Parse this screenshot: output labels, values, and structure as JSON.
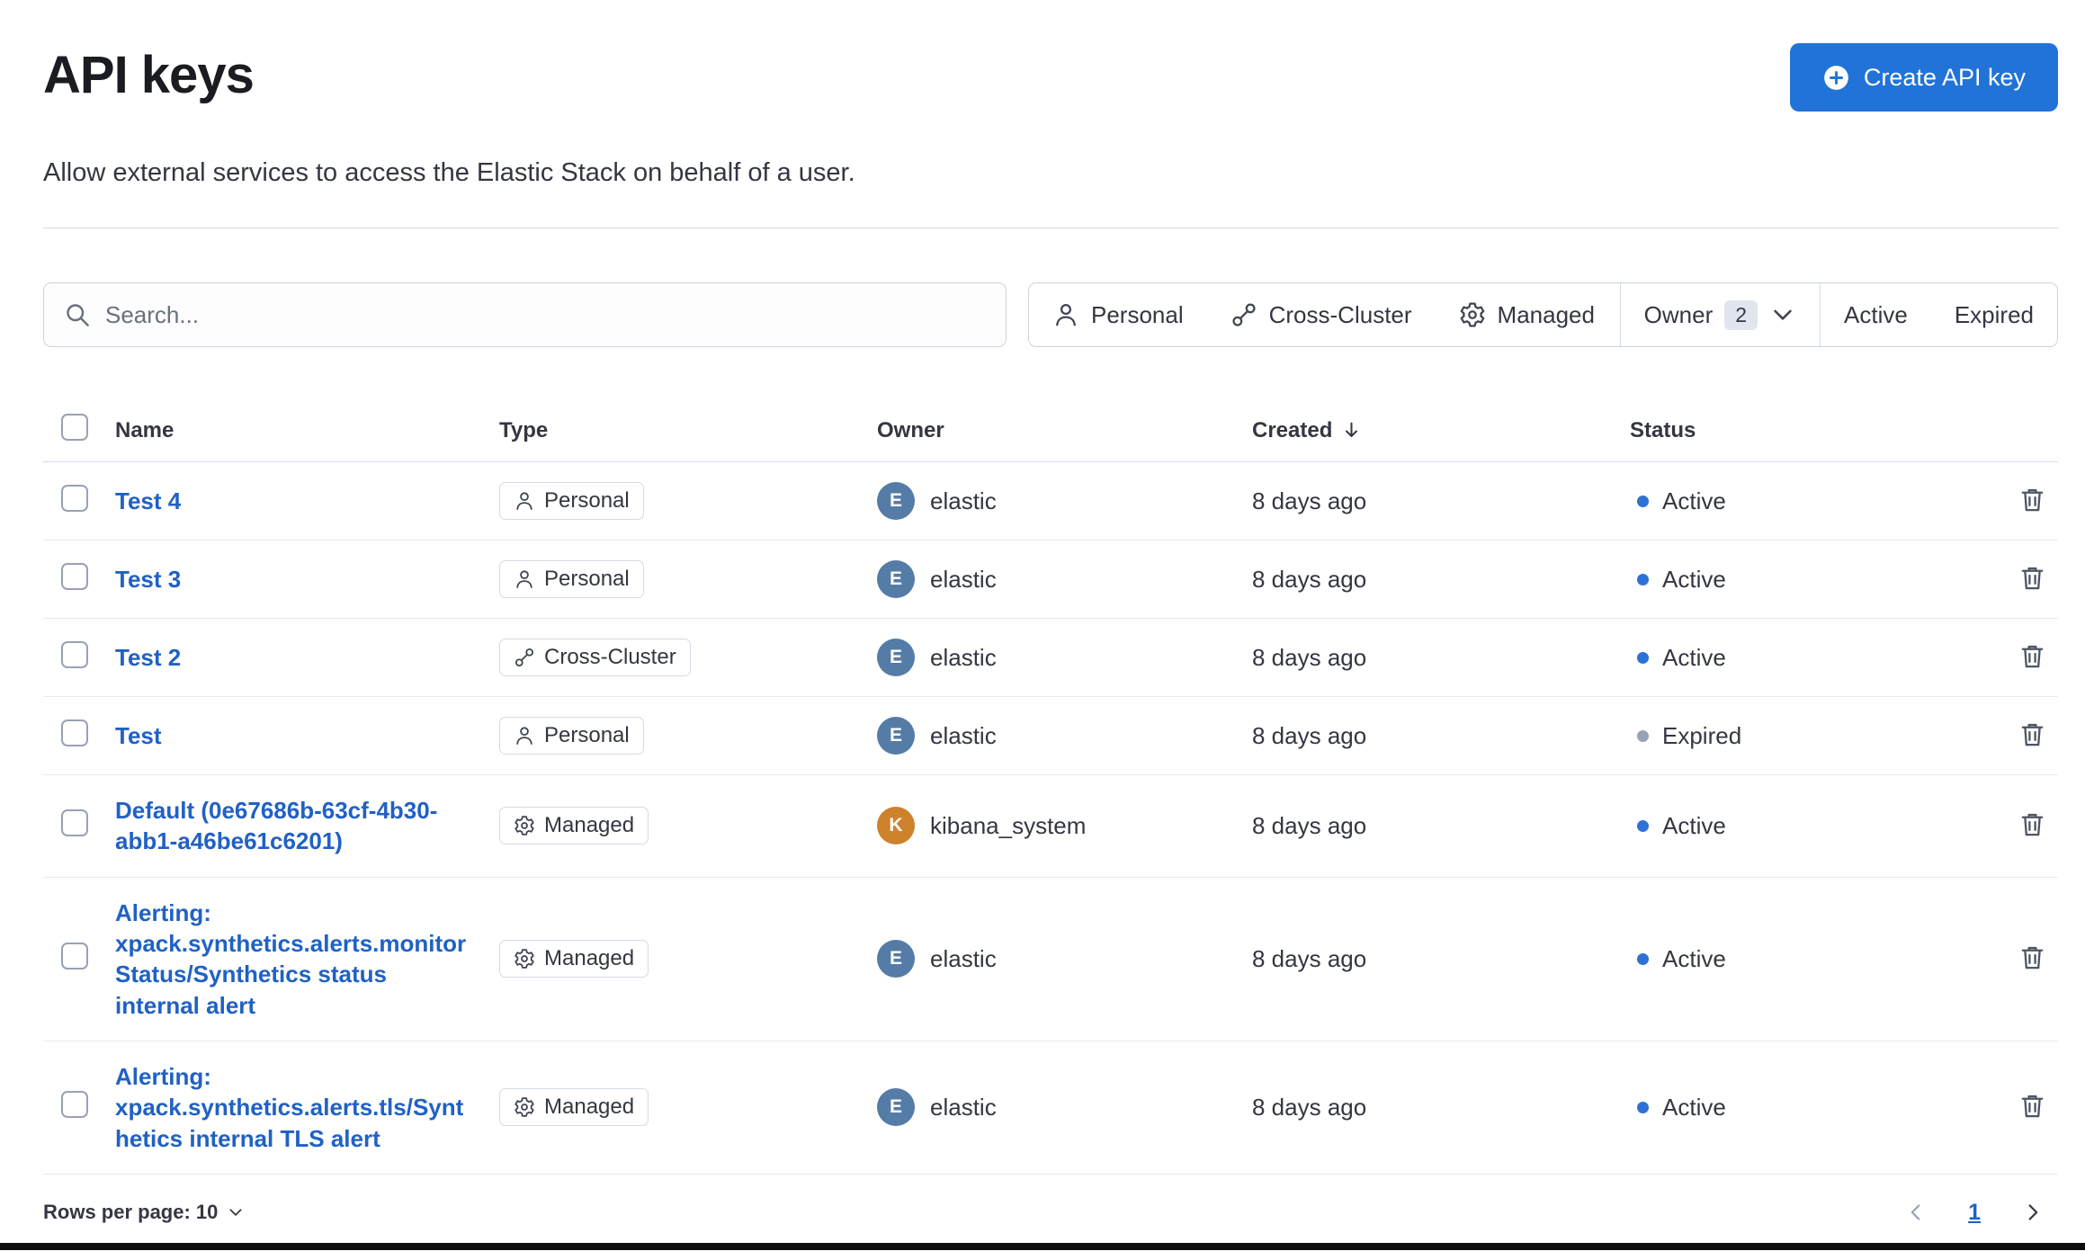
{
  "page": {
    "title": "API keys",
    "subtitle": "Allow external services to access the Elastic Stack on behalf of a user.",
    "create_button": "Create API key"
  },
  "search": {
    "placeholder": "Search..."
  },
  "filters": {
    "personal": "Personal",
    "cross_cluster": "Cross-Cluster",
    "managed": "Managed",
    "owner": {
      "label": "Owner",
      "count": "2"
    },
    "active": "Active",
    "expired": "Expired"
  },
  "table": {
    "columns": {
      "name": "Name",
      "type": "Type",
      "owner": "Owner",
      "created": "Created",
      "status": "Status"
    },
    "sort": {
      "column": "Created",
      "direction": "desc"
    },
    "rows": [
      {
        "name": "Test 4",
        "type": "Personal",
        "owner": "elastic",
        "owner_initial": "E",
        "avatar_color": "#557ca6",
        "created": "8 days ago",
        "status": "Active"
      },
      {
        "name": "Test 3",
        "type": "Personal",
        "owner": "elastic",
        "owner_initial": "E",
        "avatar_color": "#557ca6",
        "created": "8 days ago",
        "status": "Active"
      },
      {
        "name": "Test 2",
        "type": "Cross-Cluster",
        "owner": "elastic",
        "owner_initial": "E",
        "avatar_color": "#557ca6",
        "created": "8 days ago",
        "status": "Active"
      },
      {
        "name": "Test",
        "type": "Personal",
        "owner": "elastic",
        "owner_initial": "E",
        "avatar_color": "#557ca6",
        "created": "8 days ago",
        "status": "Expired"
      },
      {
        "name": "Default (0e67686b-63cf-4b30-abb1-a46be61c6201)",
        "type": "Managed",
        "owner": "kibana_system",
        "owner_initial": "K",
        "avatar_color": "#ce822c",
        "created": "8 days ago",
        "status": "Active"
      },
      {
        "name": "Alerting: xpack.synthetics.alerts.monitorStatus/Synthetics status internal alert",
        "type": "Managed",
        "owner": "elastic",
        "owner_initial": "E",
        "avatar_color": "#557ca6",
        "created": "8 days ago",
        "status": "Active"
      },
      {
        "name": "Alerting: xpack.synthetics.alerts.tls/Synthetics internal TLS alert",
        "type": "Managed",
        "owner": "elastic",
        "owner_initial": "E",
        "avatar_color": "#557ca6",
        "created": "8 days ago",
        "status": "Active"
      }
    ]
  },
  "footer": {
    "rows_per_page": "Rows per page: 10",
    "page": "1"
  },
  "colors": {
    "primary_button": "#2173d8",
    "link": "#2061c5",
    "active_dot": "#2d71d6",
    "expired_dot": "#98a2b3",
    "avatar_elastic": "#557ca6",
    "avatar_kibana_system": "#ce822c"
  }
}
